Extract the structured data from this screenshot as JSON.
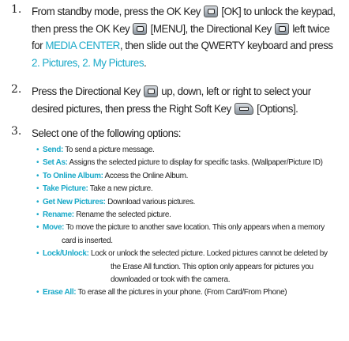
{
  "steps": [
    {
      "num": "1.",
      "lines": [
        [
          "From standby mode, press the OK Key ",
          "KEY:ok",
          " [OK] to unlock the keypad,"
        ],
        [
          "then press the OK Key ",
          "KEY:ok",
          " [MENU], the Directional Key ",
          "KEY:dir",
          " left twice"
        ],
        [
          "for ",
          "HL:MEDIA CENTER",
          ", then slide out the QWERTY keyboard and press"
        ],
        [
          "HL:2. Pictures, 2. My Pictures",
          "."
        ]
      ]
    },
    {
      "num": "2.",
      "lines": [
        [
          "Press the Directional Key ",
          "KEY:dir",
          " up, down, left or right to select your"
        ],
        [
          "desired pictures, then press the Right Soft Key ",
          "KEY:soft",
          " [Options]."
        ]
      ]
    },
    {
      "num": "3.",
      "lines": [
        [
          "Select one of the following options:"
        ]
      ]
    }
  ],
  "options": [
    {
      "label": "Send:",
      "text": " To send a picture message."
    },
    {
      "label": "Set As:",
      "text": " Assigns the selected picture to display for specific tasks. (Wallpaper/Picture ID)"
    },
    {
      "label": "To Online Album:",
      "text": " Access the Online Album."
    },
    {
      "label": "Take Picture:",
      "text": " Take a new picture."
    },
    {
      "label": "Get New Pictures:",
      "text": " Download various pictures."
    },
    {
      "label": "Rename:",
      "text": " Rename the selected picture."
    },
    {
      "label": "Move:",
      "text": " To move the picture to another save location. This only appears when a memory",
      "cont": [
        "card is inserted."
      ],
      "indent": "i1"
    },
    {
      "label": "Lock/Unlock:",
      "text": " Lock or unlock the selected picture. Locked pictures cannot be deleted by",
      "cont": [
        "the Erase All function. This option only appears for pictures you",
        "downloaded or took with the camera."
      ],
      "indent": "i2"
    },
    {
      "label": "Erase All:",
      "text": " To erase all the pictures in your phone. (From Card/From Phone)"
    }
  ]
}
